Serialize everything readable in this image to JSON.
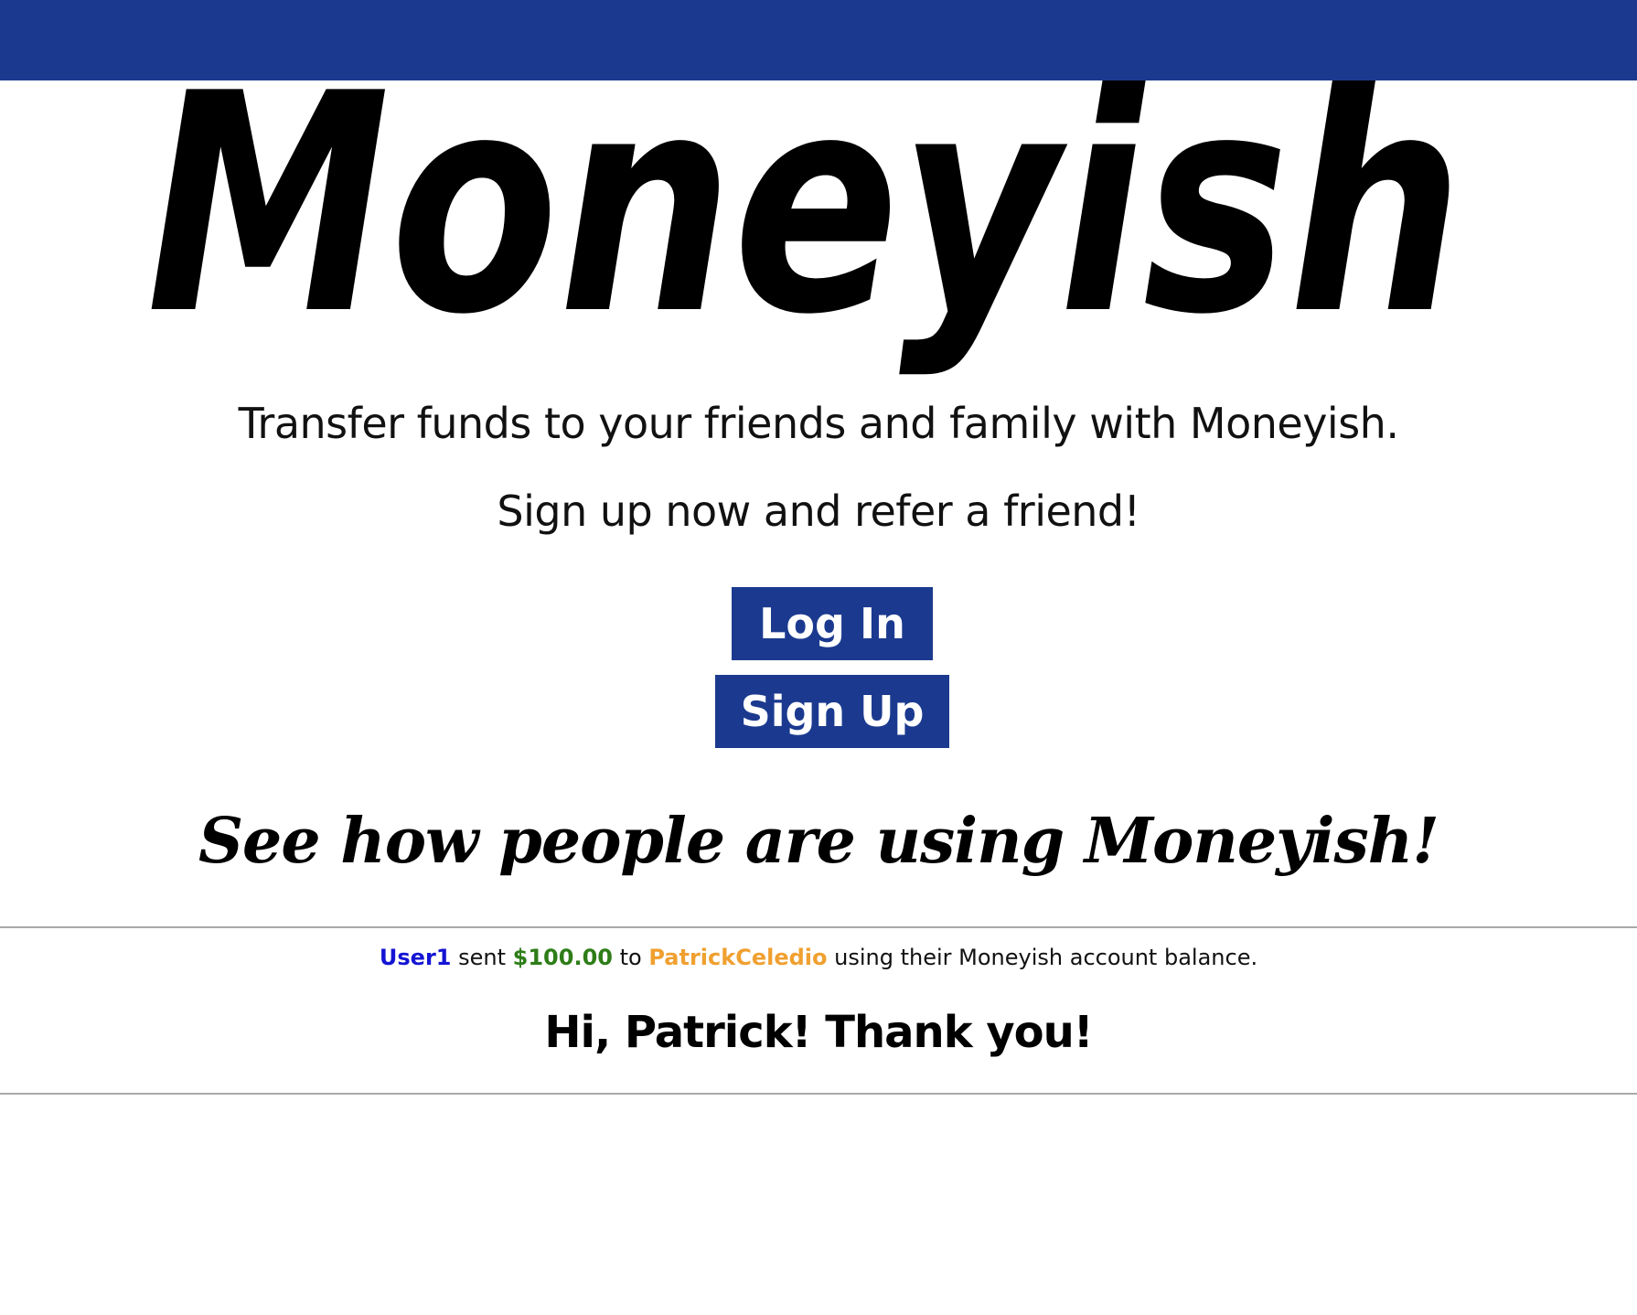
{
  "brand": {
    "logo_text": "Moneyish"
  },
  "hero": {
    "tagline_1": "Transfer funds to your friends and family with Moneyish.",
    "tagline_2": "Sign up now and refer a friend!"
  },
  "actions": {
    "login_label": "Log In",
    "signup_label": "Sign Up"
  },
  "usage": {
    "heading": "See how people are using Moneyish!"
  },
  "feed": {
    "items": [
      {
        "sender": "User1",
        "verb": "sent",
        "amount": "$100.00",
        "connector": "to",
        "receiver": "PatrickCeledio",
        "suffix": "using their Moneyish account balance.",
        "message": "Hi, Patrick! Thank you!"
      }
    ]
  },
  "colors": {
    "brand_blue": "#1b3a8f",
    "sender": "#1414d4",
    "amount": "#2e7d18",
    "receiver": "#f0a030"
  }
}
